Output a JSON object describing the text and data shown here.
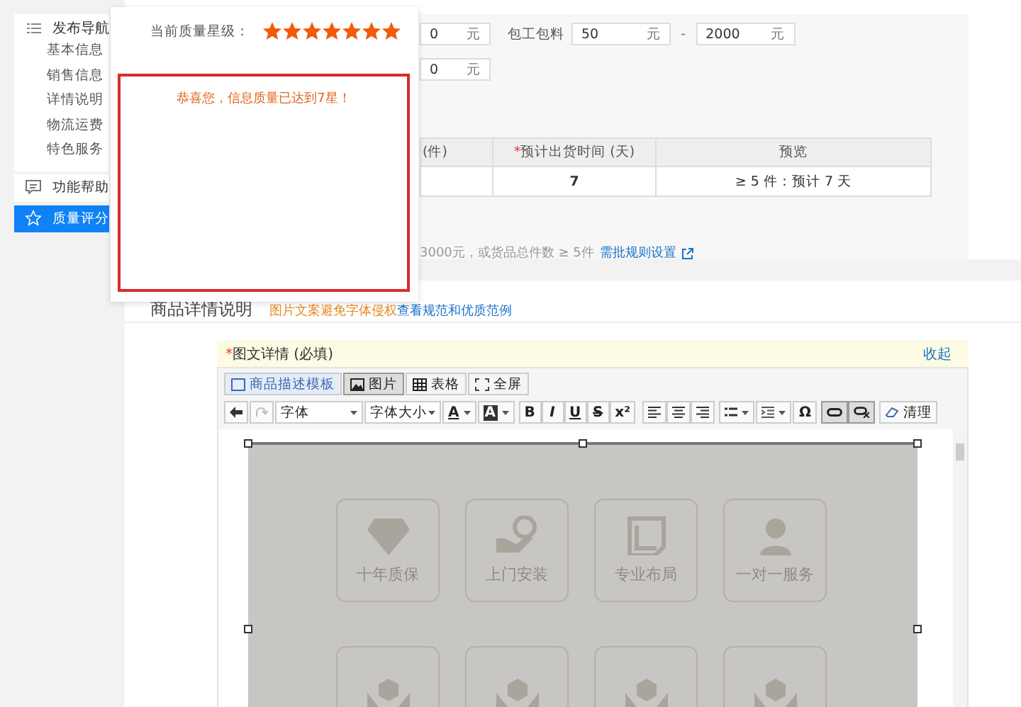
{
  "sidebar": {
    "nav": {
      "title": "发布导航",
      "items": [
        "基本信息",
        "销售信息",
        "详情说明",
        "物流运费",
        "特色服务"
      ]
    },
    "menu": [
      {
        "label": "功能帮助",
        "kind": "help",
        "selected": false
      },
      {
        "label": "质量评分",
        "kind": "star",
        "selected": true
      }
    ]
  },
  "price_form": {
    "row_1": {
      "min": {
        "value": "0",
        "unit": "元"
      },
      "label": "包工包料",
      "from": {
        "value": "50",
        "unit": "元"
      },
      "separator": "-",
      "to": {
        "value": "2000",
        "unit": "元"
      }
    },
    "row_2": {
      "value": "0",
      "unit": "元"
    }
  },
  "lead_time_table": {
    "columns": [
      {
        "label": "(件)"
      },
      {
        "label": "预计出货时间 (天)",
        "required_mark": "*"
      },
      {
        "label": "预览"
      }
    ],
    "rows": [
      {
        "days": "7",
        "preview": "≥ 5 件：预计 7 天"
      }
    ]
  },
  "note": {
    "text": "3000元，或货品总件数 ≥ 5件",
    "link": "需批规则设置"
  },
  "details": {
    "title": "商品详情说明",
    "warning": "图片文案避免字体侵权",
    "link": "查看规范和优质范例"
  },
  "editor": {
    "title": "图文详情 (必填)",
    "required_mark": "*",
    "collapse": "收起",
    "tabs": [
      {
        "label": "商品描述模板",
        "selected": false
      },
      {
        "label": "图片",
        "selected": true
      },
      {
        "label": "表格",
        "selected": false
      },
      {
        "label": "全屏",
        "selected": false
      }
    ],
    "toolbar": {
      "font": "字体",
      "size": "字体大小",
      "font_color": "A",
      "highlight": "A",
      "format": [
        "B",
        "I",
        "U",
        "S",
        "x²"
      ],
      "special": "Ω",
      "clear": "清理"
    },
    "tiles": [
      {
        "label": "十年质保"
      },
      {
        "label": "上门安装"
      },
      {
        "label": "专业布局"
      },
      {
        "label": "一对一服务"
      }
    ]
  },
  "popup": {
    "label": "当前质量星级：",
    "stars": 7,
    "message": "恭喜您，信息质量已达到7星！"
  }
}
